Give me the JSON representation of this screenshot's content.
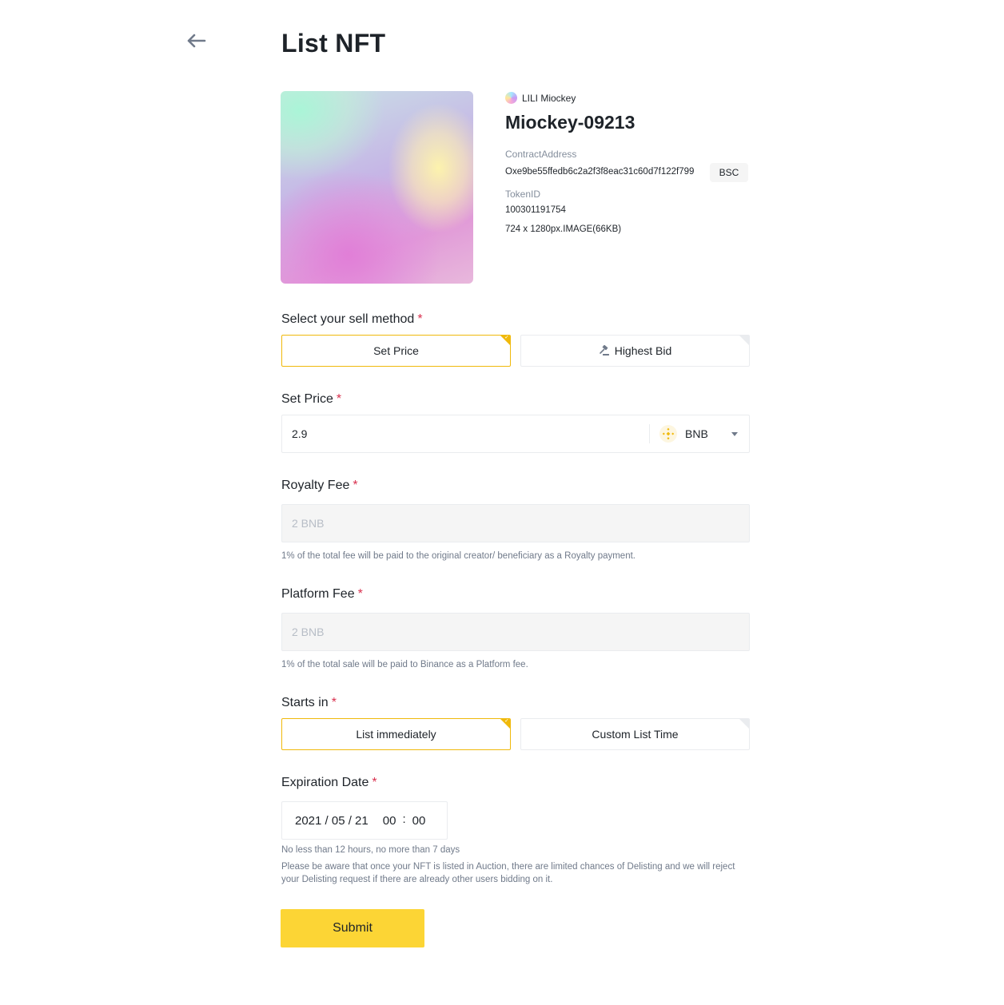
{
  "header": {
    "back_icon": "arrow-left-icon",
    "title": "List NFT"
  },
  "nft": {
    "collection_name": "LILI Miockey",
    "name": "Miockey-09213",
    "contract_label": "ContractAddress",
    "contract_address": "Oxe9be55ffedb6c2a2f3f8eac31c60d7f122f799",
    "chain": "BSC",
    "token_label": "TokenID",
    "token_id": "100301191754",
    "file_info": "724 x 1280px.IMAGE(66KB)"
  },
  "sell_method": {
    "label": "Select your sell method",
    "required": "*",
    "options": [
      "Set Price",
      "Highest Bid"
    ],
    "selected": "Set Price",
    "highest_bid_icon": "auction-hammer-icon"
  },
  "set_price": {
    "label": "Set Price",
    "required": "*",
    "value": "2.9",
    "currency": "BNB",
    "currency_icon": "bnb-icon"
  },
  "royalty_fee": {
    "label": "Royalty Fee",
    "required": "*",
    "value": "2 BNB",
    "hint": "1% of the total fee will be paid to the original creator/ beneficiary as a Royalty payment."
  },
  "platform_fee": {
    "label": "Platform Fee",
    "required": "*",
    "value": "2 BNB",
    "hint": "1% of the total sale will be paid to Binance as a Platform fee."
  },
  "starts_in": {
    "label": "Starts in",
    "required": "*",
    "options": [
      "List immediately",
      "Custom List Time"
    ],
    "selected": "List immediately"
  },
  "expiration": {
    "label": "Expiration Date",
    "required": "*",
    "date": "2021 / 05 / 21",
    "hour": "00",
    "minute": "00",
    "hint1": "No less than 12 hours, no more than 7 days",
    "hint2": "Please be aware that once your NFT is listed in Auction, there are limited chances of Delisting and we will reject your Delisting request if there are already other users bidding on it."
  },
  "submit_label": "Submit",
  "colors": {
    "accent": "#f0b90b",
    "button": "#fcd535",
    "required": "#d9304e",
    "text": "#1e2329",
    "muted": "#848e9c"
  }
}
